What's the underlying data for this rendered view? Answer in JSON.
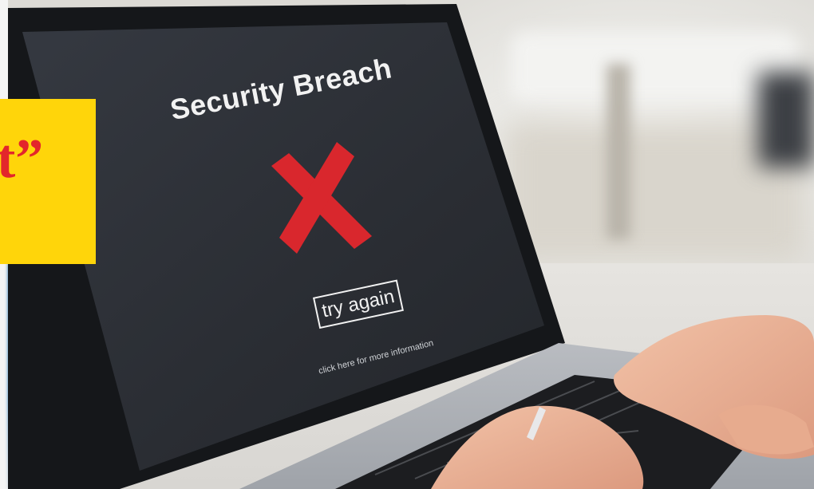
{
  "screen": {
    "title": "Security Breach",
    "button_label": "try again",
    "info_text": "click here for more information"
  },
  "overlay": {
    "text": "t”",
    "background_color": "#ffd50a",
    "text_color": "#e3262b"
  },
  "icons": {
    "error_mark": "x-mark-icon"
  },
  "colors": {
    "screen": "#2b2f36",
    "x_mark": "#d9272d"
  }
}
